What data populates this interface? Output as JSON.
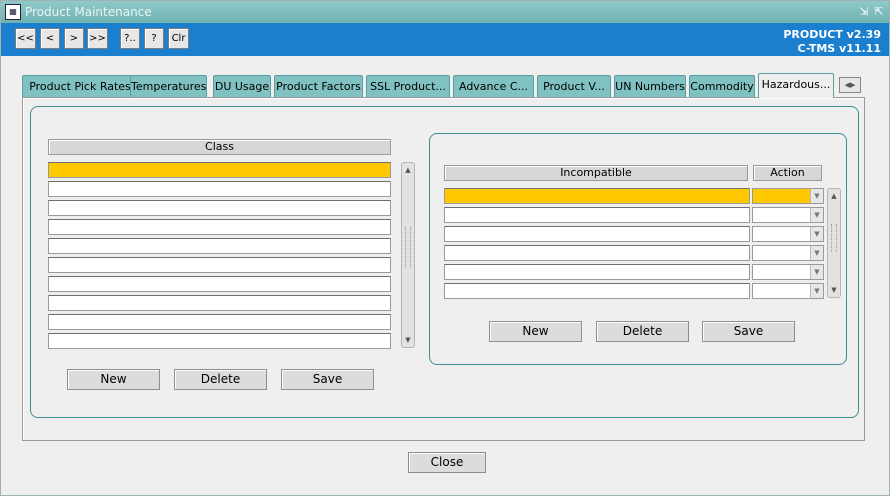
{
  "window": {
    "title": "Product Maintenance"
  },
  "toolbar": {
    "buttons": [
      {
        "id": "first",
        "label": "<<"
      },
      {
        "id": "prev",
        "label": "<"
      },
      {
        "id": "next",
        "label": ">"
      },
      {
        "id": "last",
        "label": ">>"
      },
      {
        "id": "query",
        "label": "?.."
      },
      {
        "id": "help",
        "label": "?"
      },
      {
        "id": "clear",
        "label": "Clr"
      }
    ],
    "version_line1": "PRODUCT v2.39",
    "version_line2": "C-TMS v11.11"
  },
  "tabs": [
    {
      "label": "Product Pick Rates"
    },
    {
      "label": "Temperatures"
    },
    {
      "label": "DU Usage"
    },
    {
      "label": "Product Factors"
    },
    {
      "label": "SSL Product..."
    },
    {
      "label": "Advance C..."
    },
    {
      "label": "Product V..."
    },
    {
      "label": "UN Numbers"
    },
    {
      "label": "Commodity"
    },
    {
      "label": "Hazardous...",
      "active": true
    }
  ],
  "class_block": {
    "header": "Class",
    "buttons": {
      "new": "New",
      "delete": "Delete",
      "save": "Save"
    }
  },
  "incompatible_block": {
    "header_incompatible": "Incompatible",
    "header_action": "Action",
    "buttons": {
      "new": "New",
      "delete": "Delete",
      "save": "Save"
    }
  },
  "footer": {
    "close": "Close"
  },
  "colors": {
    "selected_row": "#ffc800",
    "toolbar": "#1b7fd0",
    "titlebar": "#80c2c2",
    "tab": "#80c2c2"
  }
}
